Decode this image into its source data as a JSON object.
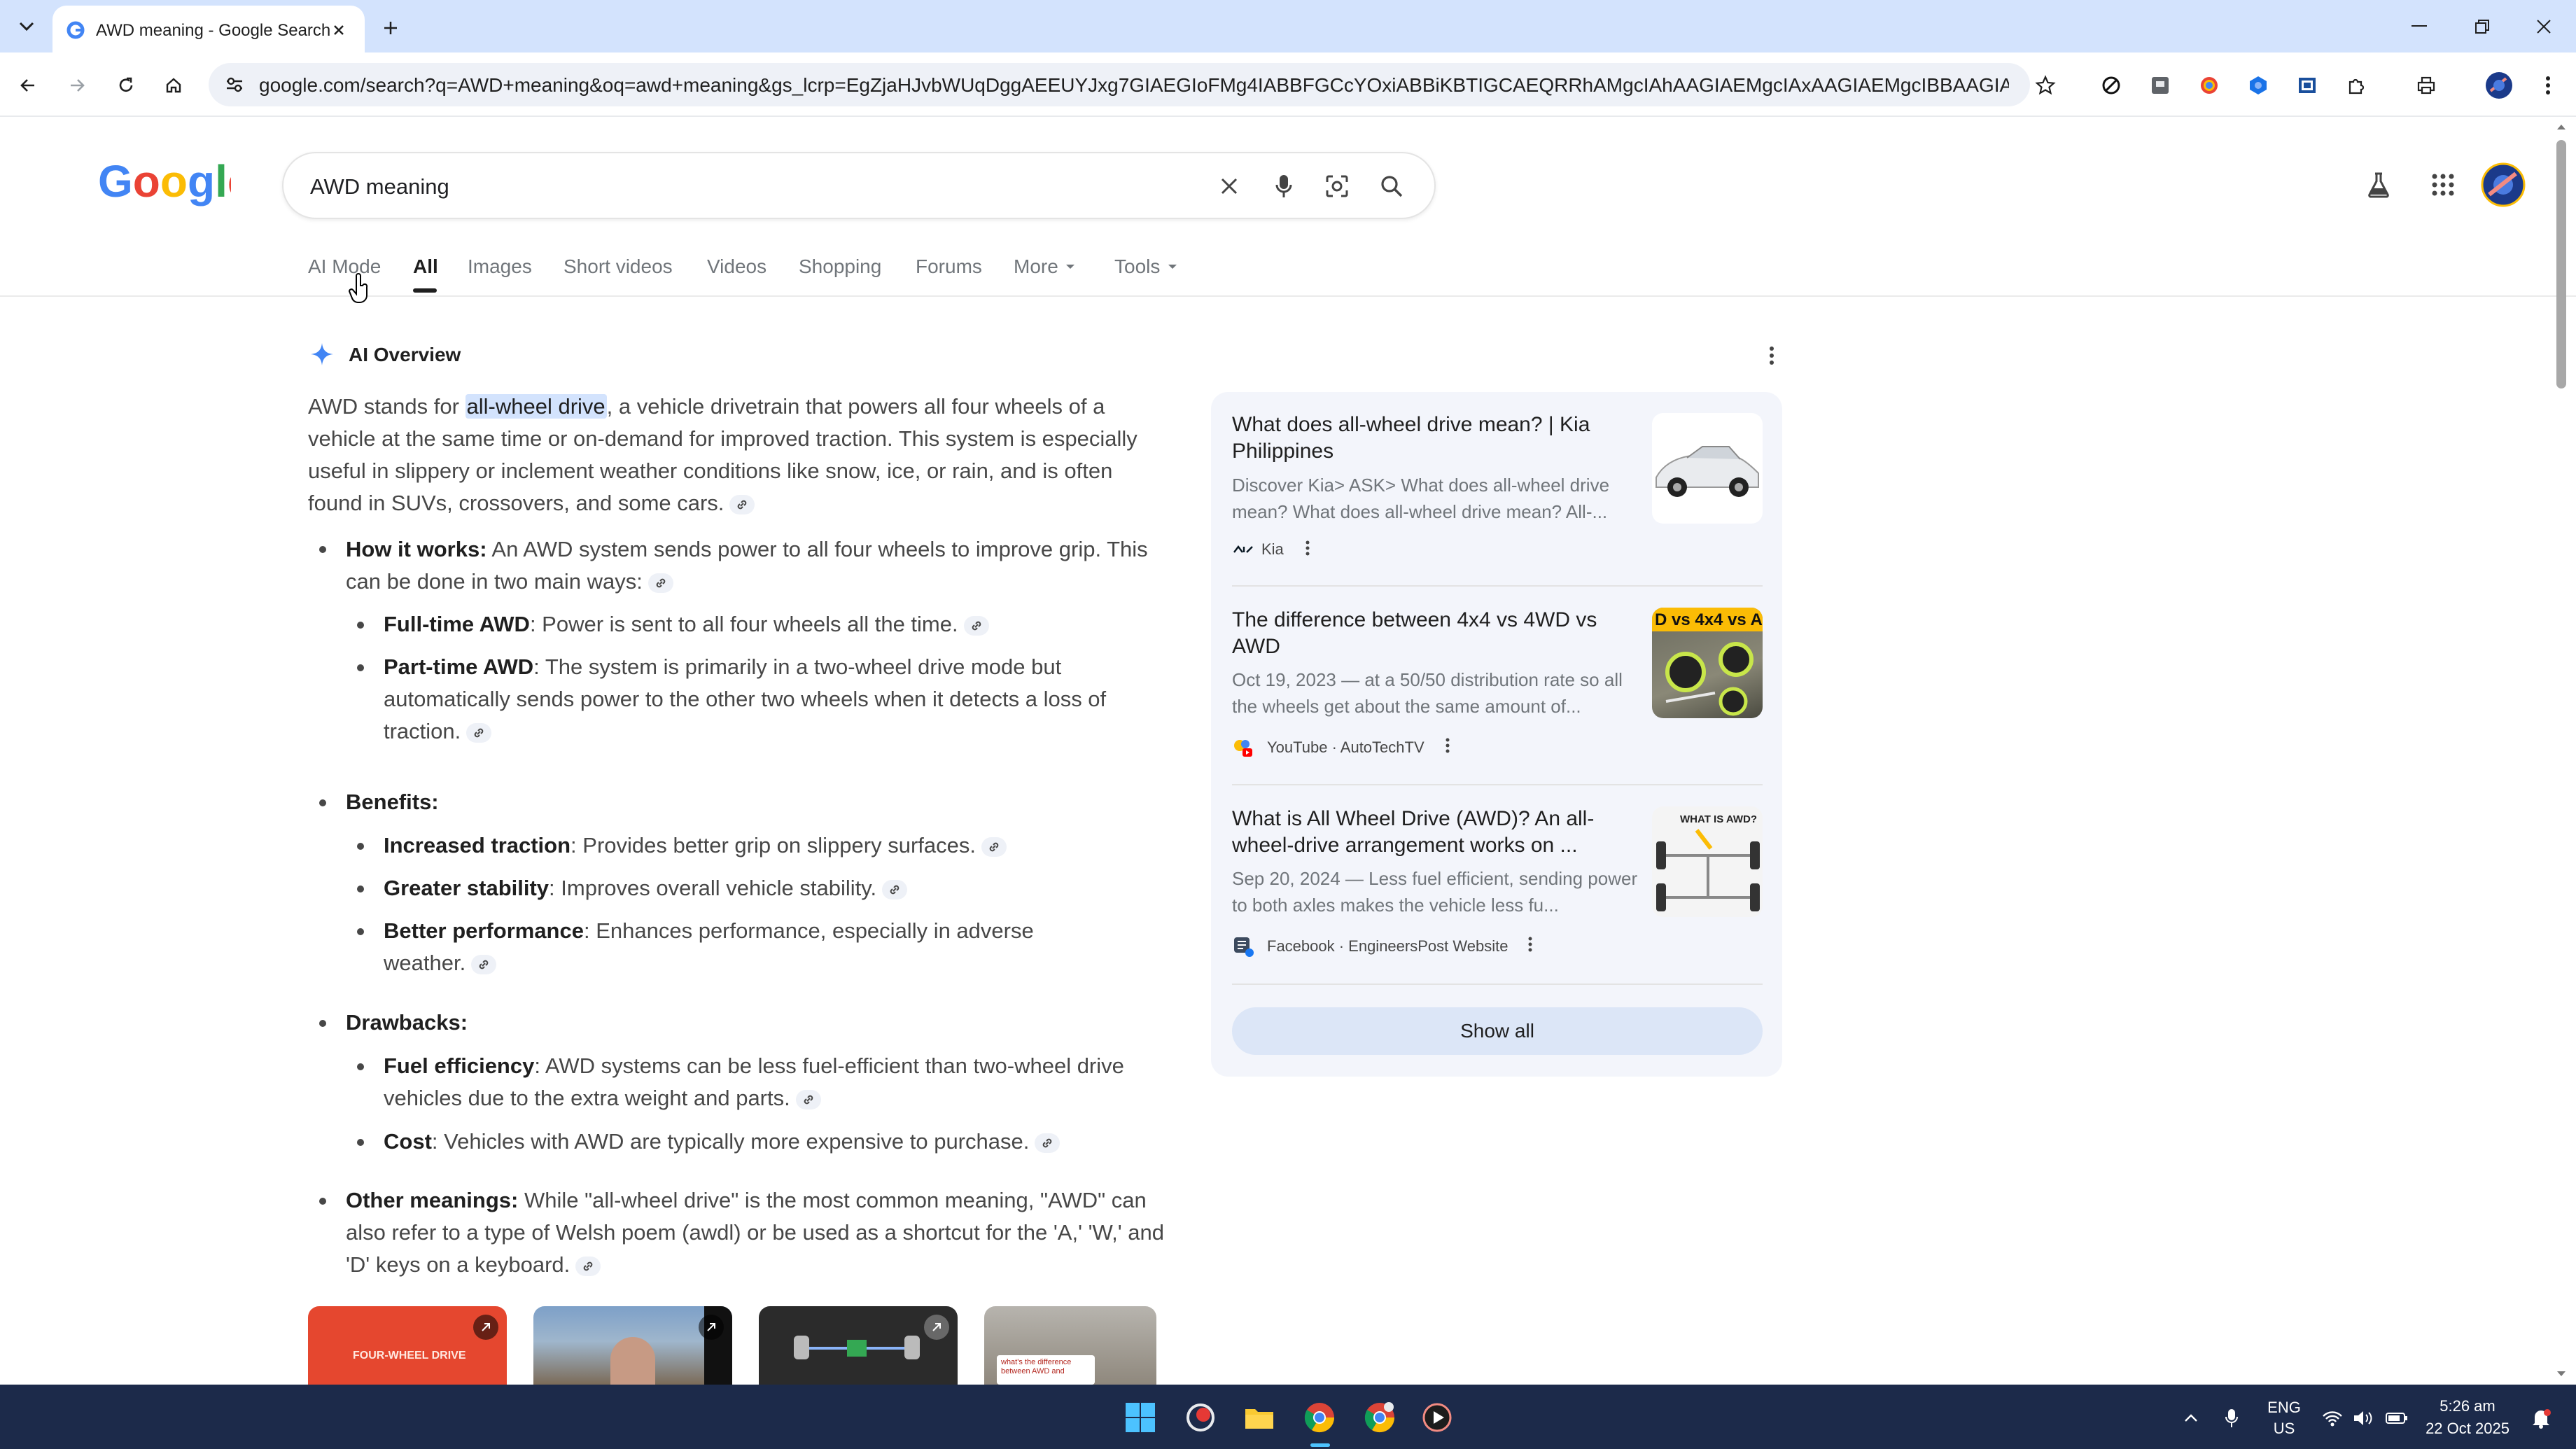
{
  "browser": {
    "tab_title": "AWD meaning - Google Search",
    "url": "google.com/search?q=AWD+meaning&oq=awd+meaning&gs_lcrp=EgZjaHJvbWUqDggAEEUYJxg7GIAEGIoFMg4IABBFGCcYOxiABBiKBTIGCAEQRRhAMgcIAhAAGIAEMgcIAxAAGIAEMgcIBBAAGIAEMgcIBRAAGIA..."
  },
  "search": {
    "logo": "Google",
    "query": "AWD meaning",
    "tabs": [
      "AI Mode",
      "All",
      "Images",
      "Short videos",
      "Videos",
      "Shopping",
      "Forums",
      "More",
      "Tools"
    ]
  },
  "ai_overview": {
    "title": "AI Overview",
    "intro_pre": "AWD stands for ",
    "intro_hl": "all-wheel drive",
    "intro_post": ", a vehicle drivetrain that powers all four wheels of a vehicle at the same time or on-demand for improved traction. This system is especially useful in slippery or inclement weather conditions like snow, ice, or rain, and is often found in SUVs, crossovers, and some cars.",
    "how_label": "How it works:",
    "how_text": " An AWD system sends power to all four wheels to improve grip. This can be done in two main ways:",
    "full_label": "Full-time AWD",
    "full_text": ": Power is sent to all four wheels all the time.",
    "part_label": "Part-time AWD",
    "part_text": ": The system is primarily in a two-wheel drive mode but automatically sends power to the other two wheels when it detects a loss of traction.",
    "benefits_label": "Benefits:",
    "b1_label": "Increased traction",
    "b1_text": ": Provides better grip on slippery surfaces.",
    "b2_label": "Greater stability",
    "b2_text": ": Improves overall vehicle stability.",
    "b3_label": "Better performance",
    "b3_text": ": Enhances performance, especially in adverse weather.",
    "drawbacks_label": "Drawbacks:",
    "d1_label": "Fuel efficiency",
    "d1_text": ": AWD systems can be less fuel-efficient than two-wheel drive vehicles due to the extra weight and parts.",
    "d2_label": "Cost",
    "d2_text": ": Vehicles with AWD are typically more expensive to purchase.",
    "other_label": "Other meanings:",
    "other_text": " While \"all-wheel drive\" is the most common meaning, \"AWD\" can also refer to a type of Welsh poem (awdl) or be used as a shortcut for the 'A,' 'W,' and 'D' keys on a keyboard."
  },
  "sources": [
    {
      "title": "What does all-wheel drive mean? | Kia Philippines",
      "snippet": "Discover Kia> ASK> What does all-wheel drive mean? What does all-wheel drive mean? All-...",
      "meta": "Kia"
    },
    {
      "title": "The difference between 4x4 vs 4WD vs AWD",
      "snippet": "Oct 19, 2023 — at a 50/50 distribution rate so all the wheels get about the same amount of...",
      "meta": "YouTube · AutoTechTV",
      "thumb_text": "D vs 4x4 vs A"
    },
    {
      "title": "What is All Wheel Drive (AWD)? An all-wheel-drive arrangement works on ...",
      "snippet": "Sep 20, 2024 — Less fuel efficient, sending power to both axles makes the vehicle less fu...",
      "meta": "Facebook · EngineersPost Website",
      "thumb_text": "WHAT IS AWD?"
    }
  ],
  "show_all": "Show all",
  "videos": [
    {
      "thumb_text": "FOUR-WHEEL DRIVE"
    },
    {
      "thumb_text": ""
    },
    {
      "thumb_text": ""
    },
    {
      "thumb_text": "what's the difference between AWD and"
    }
  ],
  "taskbar": {
    "lang_top": "ENG",
    "lang_bottom": "US",
    "time": "5:26 am",
    "date": "22 Oct 2025"
  },
  "colors": {
    "google_blue": "#4285F4",
    "google_red": "#EA4335",
    "google_yellow": "#FBBC05",
    "google_green": "#34A853",
    "tabstrip": "#d3e3fd",
    "taskbar": "#1c2a4a"
  }
}
